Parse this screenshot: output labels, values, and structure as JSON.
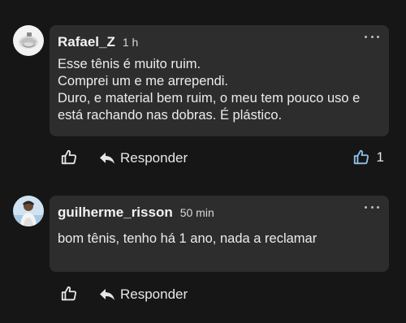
{
  "comments": [
    {
      "author": "Rafael_Z",
      "time": "1 h",
      "text": "Esse tênis é muito ruim.\nComprei um e me arrependi.\nDuro, e material bem ruim, o meu tem pouco uso e está rachando nas dobras. É plástico.",
      "like_count": "1",
      "reply_label": "Responder"
    },
    {
      "author": "guilherme_risson",
      "time": "50 min",
      "text": "bom tênis, tenho há 1 ano, nada a reclamar",
      "reply_label": "Responder"
    }
  ],
  "icons": {
    "like": "thumbs-up-icon",
    "reply": "reply-arrow-icon",
    "more": "more-horizontal-icon"
  },
  "colors": {
    "background": "#161616",
    "bubble": "#2d2d2d",
    "liked_accent": "#8fc3ea"
  }
}
